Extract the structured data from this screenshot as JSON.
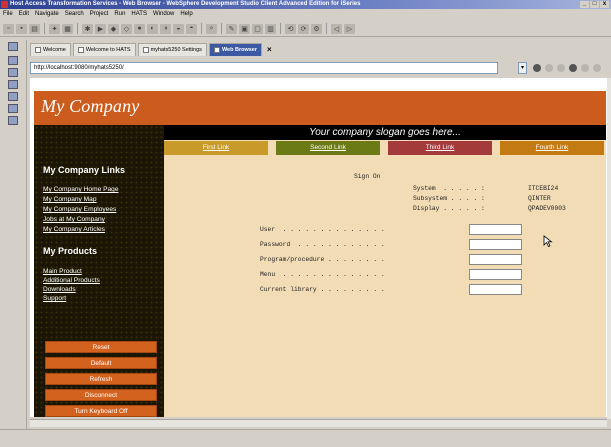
{
  "window": {
    "title": "Host Access Transformation Services - Web Browser - WebSphere Development Studio Client Advanced Edition for iSeries",
    "controls": [
      "_",
      "□",
      "x"
    ]
  },
  "menubar": [
    "File",
    "Edit",
    "Navigate",
    "Search",
    "Project",
    "Run",
    "HATS",
    "Window",
    "Help"
  ],
  "tabs": [
    {
      "label": "Welcome",
      "active": false
    },
    {
      "label": "Welcome to HATS",
      "active": false
    },
    {
      "label": "myhats5250 Settings",
      "active": false
    },
    {
      "label": "Web Browser",
      "active": true
    }
  ],
  "address": {
    "url": "http://localhost:9080/myhats5250/"
  },
  "page": {
    "company": "My Company",
    "slogan": "Your company slogan goes here...",
    "nav_links": [
      {
        "label": "First Link",
        "color": "#c89a2a"
      },
      {
        "label": "Second Link",
        "color": "#6b7a14"
      },
      {
        "label": "Third Link",
        "color": "#a43b3b"
      },
      {
        "label": "Fourth Link",
        "color": "#c47a12"
      }
    ],
    "company_links_heading": "My Company Links",
    "company_links": [
      "My Company Home Page",
      "My Company Map",
      "My Company Employees",
      "Jobs at My Company",
      "My Company Articles"
    ],
    "products_heading": "My Products",
    "product_links": [
      "Main Product",
      "Additional Products",
      "Downloads",
      "Support"
    ],
    "buttons": [
      "Reset",
      "Default",
      "Refresh",
      "Disconnect",
      "Turn Keyboard Off"
    ],
    "signon": {
      "title": "Sign On",
      "system_label": "System  . . . . . :",
      "system_value": "ITCEBI24",
      "subsystem_label": "Subsystem . . . . :",
      "subsystem_value": "QINTER",
      "display_label": "Display . . . . . :",
      "display_value": "QPADEV0003",
      "fields": [
        {
          "label": "User  . . . . . . . . . . . . . .",
          "value": ""
        },
        {
          "label": "Password  . . . . . . . . . . . .",
          "value": ""
        },
        {
          "label": "Program/procedure . . . . . . . .",
          "value": ""
        },
        {
          "label": "Menu  . . . . . . . . . . . . . .",
          "value": ""
        },
        {
          "label": "Current library . . . . . . . . .",
          "value": ""
        }
      ]
    }
  },
  "colors": {
    "header": "#cc5c1e",
    "main_bg": "#f2dcb5",
    "sidebar_bg": "#1a1504",
    "button": "#d4621f",
    "active_tab": "#3b5aa3"
  }
}
